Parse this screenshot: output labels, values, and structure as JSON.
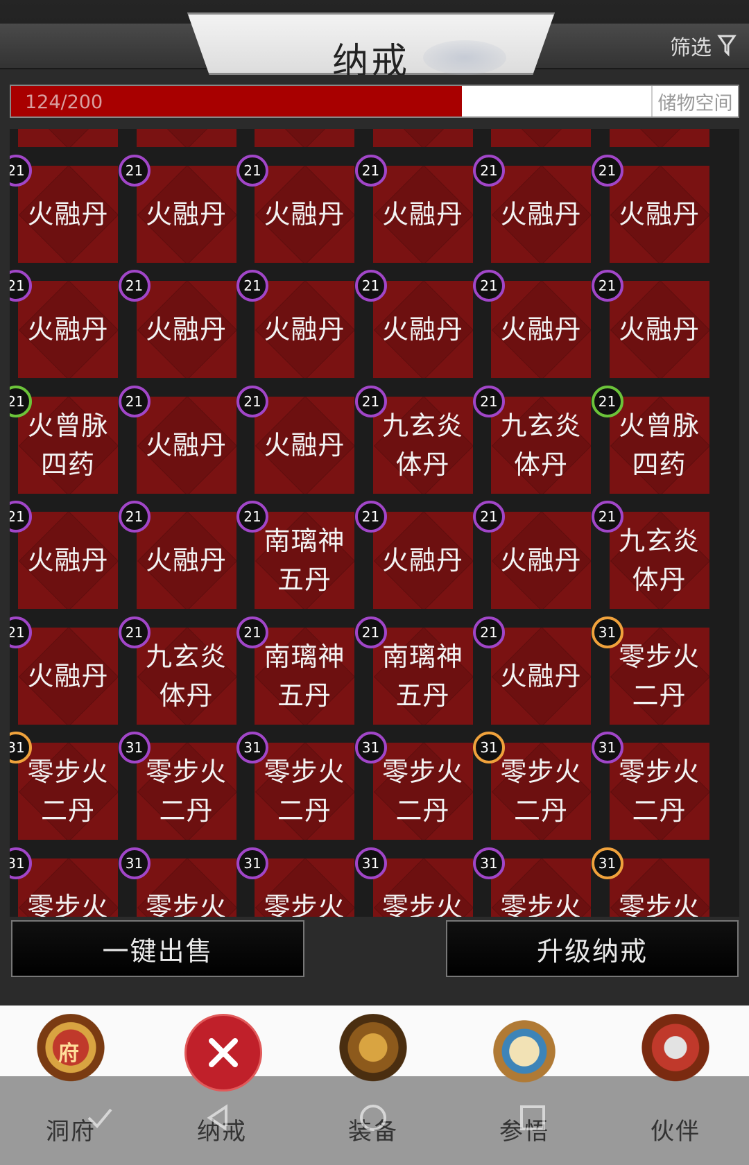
{
  "header": {
    "title": "纳戒",
    "filter_label": "筛选",
    "filter_icon": "filter-funnel-icon"
  },
  "capacity": {
    "count_text": "124/200",
    "fill_fraction": 0.62,
    "label": "储物空间",
    "fill_color": "#a80000"
  },
  "grid": {
    "rows": [
      [
        {
          "level": "21",
          "badge": "purple",
          "name": "火融丹"
        },
        {
          "level": "21",
          "badge": "purple",
          "name": "火融丹"
        },
        {
          "level": "21",
          "badge": "purple",
          "name": "火融丹"
        },
        {
          "level": "21",
          "badge": "purple",
          "name": "火融丹"
        },
        {
          "level": "21",
          "badge": "purple",
          "name": "火融丹"
        },
        {
          "level": "21",
          "badge": "purple",
          "name": "火融丹"
        }
      ],
      [
        {
          "level": "21",
          "badge": "purple",
          "name": "火融丹"
        },
        {
          "level": "21",
          "badge": "purple",
          "name": "火融丹"
        },
        {
          "level": "21",
          "badge": "purple",
          "name": "火融丹"
        },
        {
          "level": "21",
          "badge": "purple",
          "name": "火融丹"
        },
        {
          "level": "21",
          "badge": "purple",
          "name": "火融丹"
        },
        {
          "level": "21",
          "badge": "purple",
          "name": "火融丹"
        }
      ],
      [
        {
          "level": "21",
          "badge": "green",
          "name": "火曾脉\n四药"
        },
        {
          "level": "21",
          "badge": "purple",
          "name": "火融丹"
        },
        {
          "level": "21",
          "badge": "purple",
          "name": "火融丹"
        },
        {
          "level": "21",
          "badge": "purple",
          "name": "九玄炎\n体丹"
        },
        {
          "level": "21",
          "badge": "purple",
          "name": "九玄炎\n体丹"
        },
        {
          "level": "21",
          "badge": "green",
          "name": "火曾脉\n四药"
        }
      ],
      [
        {
          "level": "21",
          "badge": "purple",
          "name": "火融丹"
        },
        {
          "level": "21",
          "badge": "purple",
          "name": "火融丹"
        },
        {
          "level": "21",
          "badge": "purple",
          "name": "南璃神\n五丹"
        },
        {
          "level": "21",
          "badge": "purple",
          "name": "火融丹"
        },
        {
          "level": "21",
          "badge": "purple",
          "name": "火融丹"
        },
        {
          "level": "21",
          "badge": "purple",
          "name": "九玄炎\n体丹"
        }
      ],
      [
        {
          "level": "21",
          "badge": "purple",
          "name": "火融丹"
        },
        {
          "level": "21",
          "badge": "purple",
          "name": "九玄炎\n体丹"
        },
        {
          "level": "21",
          "badge": "purple",
          "name": "南璃神\n五丹"
        },
        {
          "level": "21",
          "badge": "purple",
          "name": "南璃神\n五丹"
        },
        {
          "level": "21",
          "badge": "purple",
          "name": "火融丹"
        },
        {
          "level": "31",
          "badge": "orange",
          "name": "零步火\n二丹"
        }
      ],
      [
        {
          "level": "31",
          "badge": "orange",
          "name": "零步火\n二丹"
        },
        {
          "level": "31",
          "badge": "purple",
          "name": "零步火\n二丹"
        },
        {
          "level": "31",
          "badge": "purple",
          "name": "零步火\n二丹"
        },
        {
          "level": "31",
          "badge": "purple",
          "name": "零步火\n二丹"
        },
        {
          "level": "31",
          "badge": "orange",
          "name": "零步火\n二丹"
        },
        {
          "level": "31",
          "badge": "purple",
          "name": "零步火\n二丹"
        }
      ],
      [
        {
          "level": "31",
          "badge": "purple",
          "name": "零步火"
        },
        {
          "level": "31",
          "badge": "purple",
          "name": "零步火"
        },
        {
          "level": "31",
          "badge": "purple",
          "name": "零步火"
        },
        {
          "level": "31",
          "badge": "purple",
          "name": "零步火"
        },
        {
          "level": "31",
          "badge": "purple",
          "name": "零步火"
        },
        {
          "level": "31",
          "badge": "orange",
          "name": "零步火"
        }
      ]
    ]
  },
  "actions": {
    "sell_all_label": "一键出售",
    "upgrade_label": "升级纳戒"
  },
  "nav": {
    "items": [
      {
        "label": "洞府",
        "icon": "dongfu-mansion-icon",
        "icon_text": "府"
      },
      {
        "label": "纳戒",
        "icon": "close-icon"
      },
      {
        "label": "装备",
        "icon": "equipment-helmet-icon"
      },
      {
        "label": "参悟",
        "icon": "scroll-icon"
      },
      {
        "label": "伙伴",
        "icon": "partner-warrior-icon"
      }
    ]
  }
}
